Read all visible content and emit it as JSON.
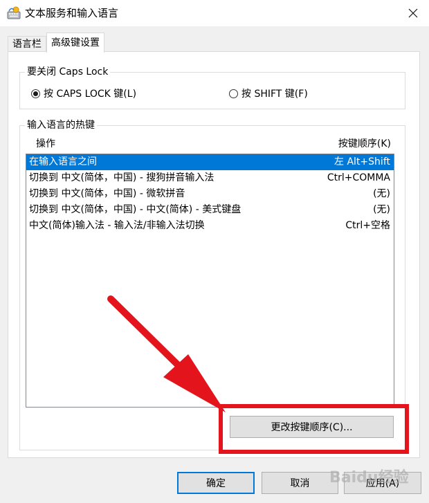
{
  "window": {
    "title": "文本服务和输入语言",
    "close_glyph": "✕"
  },
  "tabs": [
    {
      "label": "语言栏",
      "active": false
    },
    {
      "label": "高级键设置",
      "active": true
    }
  ],
  "caps_lock": {
    "legend": "要关闭 Caps Lock",
    "options": [
      {
        "label": "按 CAPS LOCK 键(L)",
        "checked": true
      },
      {
        "label": "按 SHIFT 键(F)",
        "checked": false
      }
    ]
  },
  "hotkeys": {
    "legend": "输入语言的热键",
    "col_action": "操作",
    "col_sequence": "按键顺序(K)",
    "rows": [
      {
        "action": "在输入语言之间",
        "keys": "左 Alt+Shift",
        "selected": true
      },
      {
        "action": "切换到 中文(简体，中国) - 搜狗拼音输入法",
        "keys": "Ctrl+COMMA",
        "selected": false
      },
      {
        "action": "切换到 中文(简体，中国) - 微软拼音",
        "keys": "(无)",
        "selected": false
      },
      {
        "action": "切换到 中文(简体，中国) - 中文(简体) - 美式键盘",
        "keys": "(无)",
        "selected": false
      },
      {
        "action": "中文(简体)输入法 - 输入法/非输入法切换",
        "keys": "Ctrl+空格",
        "selected": false
      }
    ],
    "change_button": "更改按键顺序(C)..."
  },
  "footer": {
    "ok": "确定",
    "cancel": "取消",
    "apply": "应用(A)"
  },
  "watermark": "Baidu经验",
  "colors": {
    "selection": "#0078d7",
    "annotation": "#e4141d"
  }
}
